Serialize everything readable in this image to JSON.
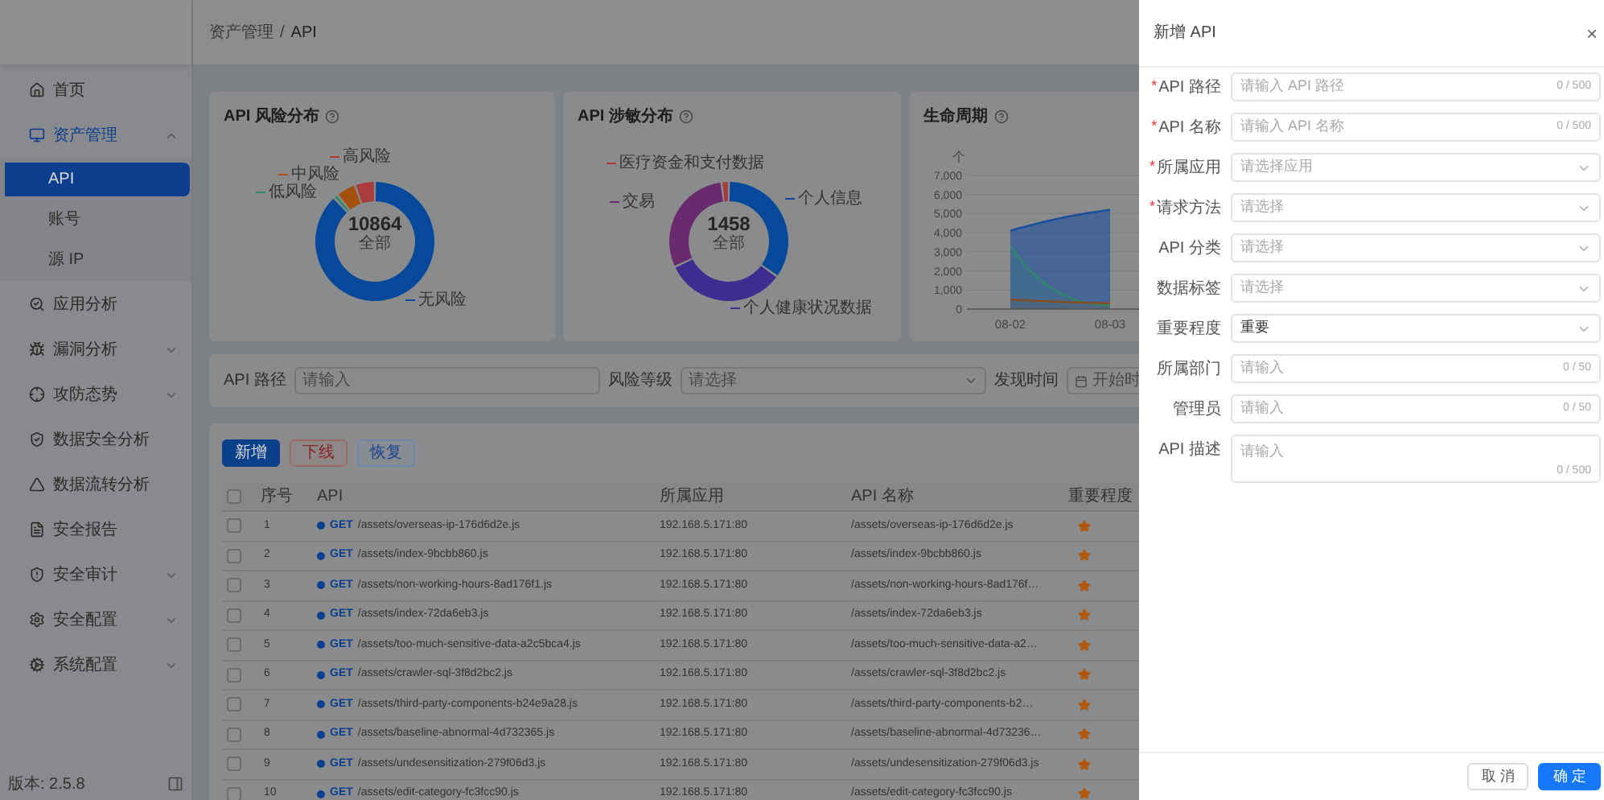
{
  "sidebar": {
    "items": [
      {
        "label": "首页",
        "selected": false
      },
      {
        "label": "资产管理",
        "expanded": true,
        "children": [
          {
            "label": "API",
            "selected": true
          },
          {
            "label": "账号",
            "selected": false
          },
          {
            "label": "源 IP",
            "selected": false
          }
        ]
      },
      {
        "label": "应用分析",
        "selected": false
      },
      {
        "label": "漏洞分析",
        "selected": false,
        "expanded": false
      },
      {
        "label": "攻防态势",
        "selected": false,
        "expanded": false
      },
      {
        "label": "数据安全分析",
        "selected": false
      },
      {
        "label": "数据流转分析",
        "selected": false
      },
      {
        "label": "安全报告",
        "selected": false
      },
      {
        "label": "安全审计",
        "selected": false,
        "expanded": false
      },
      {
        "label": "安全配置",
        "selected": false,
        "expanded": false
      },
      {
        "label": "系统配置",
        "selected": false,
        "expanded": false
      }
    ],
    "version": "版本: 2.5.8"
  },
  "breadcrumb": [
    "资产管理",
    "/",
    "API"
  ],
  "cards": [
    {
      "title": "API 风险分布",
      "total": "10864",
      "total_label": "全部",
      "slices": [
        {
          "label": "无风险",
          "color": "#06489a"
        },
        {
          "label": "低风险",
          "color": "#2a8a6a"
        },
        {
          "label": "中风险",
          "color": "#a4500e"
        },
        {
          "label": "高风险",
          "color": "#a83c3c"
        }
      ]
    },
    {
      "title": "API 涉敏分布",
      "total": "1458",
      "total_label": "全部",
      "slices": [
        {
          "label": "个人信息",
          "color": "#06489a"
        },
        {
          "label": "个人健康状况数据",
          "color": "#3e2c90"
        },
        {
          "label": "交易",
          "color": "#6a2a6e"
        },
        {
          "label": "医疗资金和支付数据",
          "color": "#a83c3c"
        }
      ]
    },
    {
      "title": "生命周期",
      "chart_data": {
        "type": "area",
        "ylabel": "个",
        "grid": true,
        "x": [
          "08-02",
          "08-03"
        ],
        "yticks": [
          {
            "value": 0,
            "label": "0"
          },
          {
            "value": 1000,
            "label": "1,000"
          },
          {
            "value": 2000,
            "label": "2,000"
          },
          {
            "value": 3000,
            "label": "3,000"
          },
          {
            "value": 4000,
            "label": "4,000"
          },
          {
            "value": 5000,
            "label": "5,000"
          },
          {
            "value": 6000,
            "label": "6,000"
          },
          {
            "value": 7000,
            "label": "7,000"
          }
        ],
        "ylim": [
          0,
          7000
        ],
        "series": [
          {
            "color": "#1a4f9c",
            "values": [
              4100,
              5200
            ]
          },
          {
            "color": "#2a8a6a",
            "values": [
              3300,
              200
            ]
          },
          {
            "color": "#8a4a1a",
            "values": [
              500,
              300
            ]
          }
        ]
      }
    }
  ],
  "filters": [
    {
      "label": "API 路径",
      "kind": "input",
      "placeholder": "请输入"
    },
    {
      "label": "风险等级",
      "kind": "select",
      "placeholder": "请选择"
    },
    {
      "label": "发现时间",
      "kind": "date",
      "placeholder": "开始时"
    }
  ],
  "actions": [
    {
      "label": "新增",
      "kind": "primary"
    },
    {
      "label": "下线",
      "kind": "danger"
    },
    {
      "label": "恢复",
      "kind": "default"
    }
  ],
  "table": {
    "checked": false,
    "columns": [
      "序号",
      "API",
      "所属应用",
      "API 名称",
      "重要程度"
    ],
    "rows": [
      {
        "checked": false,
        "no": "1",
        "method": "GET",
        "path": "/assets/overseas-ip-176d6d2e.js",
        "app": "192.168.5.171:80",
        "name": "/assets/overseas-ip-176d6d2e.js"
      },
      {
        "checked": false,
        "no": "2",
        "method": "GET",
        "path": "/assets/index-9bcbb860.js",
        "app": "192.168.5.171:80",
        "name": "/assets/index-9bcbb860.js"
      },
      {
        "checked": false,
        "no": "3",
        "method": "GET",
        "path": "/assets/non-working-hours-8ad176f1.js",
        "app": "192.168.5.171:80",
        "name": "/assets/non-working-hours-8ad176f…"
      },
      {
        "checked": false,
        "no": "4",
        "method": "GET",
        "path": "/assets/index-72da6eb3.js",
        "app": "192.168.5.171:80",
        "name": "/assets/index-72da6eb3.js"
      },
      {
        "checked": false,
        "no": "5",
        "method": "GET",
        "path": "/assets/too-much-sensitive-data-a2c5bca4.js",
        "app": "192.168.5.171:80",
        "name": "/assets/too-much-sensitive-data-a2…"
      },
      {
        "checked": false,
        "no": "6",
        "method": "GET",
        "path": "/assets/crawler-sql-3f8d2bc2.js",
        "app": "192.168.5.171:80",
        "name": "/assets/crawler-sql-3f8d2bc2.js"
      },
      {
        "checked": false,
        "no": "7",
        "method": "GET",
        "path": "/assets/third-party-components-b24e9a28.js",
        "app": "192.168.5.171:80",
        "name": "/assets/third-party-components-b2…"
      },
      {
        "checked": false,
        "no": "8",
        "method": "GET",
        "path": "/assets/baseline-abnormal-4d732365.js",
        "app": "192.168.5.171:80",
        "name": "/assets/baseline-abnormal-4d73236…"
      },
      {
        "checked": false,
        "no": "9",
        "method": "GET",
        "path": "/assets/undesensitization-279f06d3.js",
        "app": "192.168.5.171:80",
        "name": "/assets/undesensitization-279f06d3.js"
      },
      {
        "checked": false,
        "no": "10",
        "method": "GET",
        "path": "/assets/edit-category-fc3fcc90.js",
        "app": "192.168.5.171:80",
        "name": "/assets/edit-category-fc3fcc90.js"
      }
    ]
  },
  "drawer": {
    "title": "新增 API",
    "close": "×",
    "required_mark": "*",
    "fields": [
      {
        "label": "API 路径",
        "required": true,
        "kind": "input",
        "placeholder": "请输入 API 路径",
        "counter": "0 / 500"
      },
      {
        "label": "API 名称",
        "required": true,
        "kind": "input",
        "placeholder": "请输入 API 名称",
        "counter": "0 / 500"
      },
      {
        "label": "所属应用",
        "required": true,
        "kind": "select",
        "placeholder": "请选择应用"
      },
      {
        "label": "请求方法",
        "required": true,
        "kind": "select",
        "placeholder": "请选择"
      },
      {
        "label": "API 分类",
        "required": false,
        "kind": "select",
        "placeholder": "请选择"
      },
      {
        "label": "数据标签",
        "required": false,
        "kind": "select",
        "placeholder": "请选择"
      },
      {
        "label": "重要程度",
        "required": false,
        "kind": "select",
        "value": "重要"
      },
      {
        "label": "所属部门",
        "required": false,
        "kind": "input",
        "placeholder": "请输入",
        "counter": "0 / 50"
      },
      {
        "label": "管理员",
        "required": false,
        "kind": "input",
        "placeholder": "请输入",
        "counter": "0 / 50"
      },
      {
        "label": "API 描述",
        "required": false,
        "kind": "textarea",
        "placeholder": "请输入",
        "counter": "0 / 500"
      }
    ],
    "buttons": [
      {
        "label": "取 消",
        "kind": "default"
      },
      {
        "label": "确 定",
        "kind": "primary"
      }
    ]
  }
}
